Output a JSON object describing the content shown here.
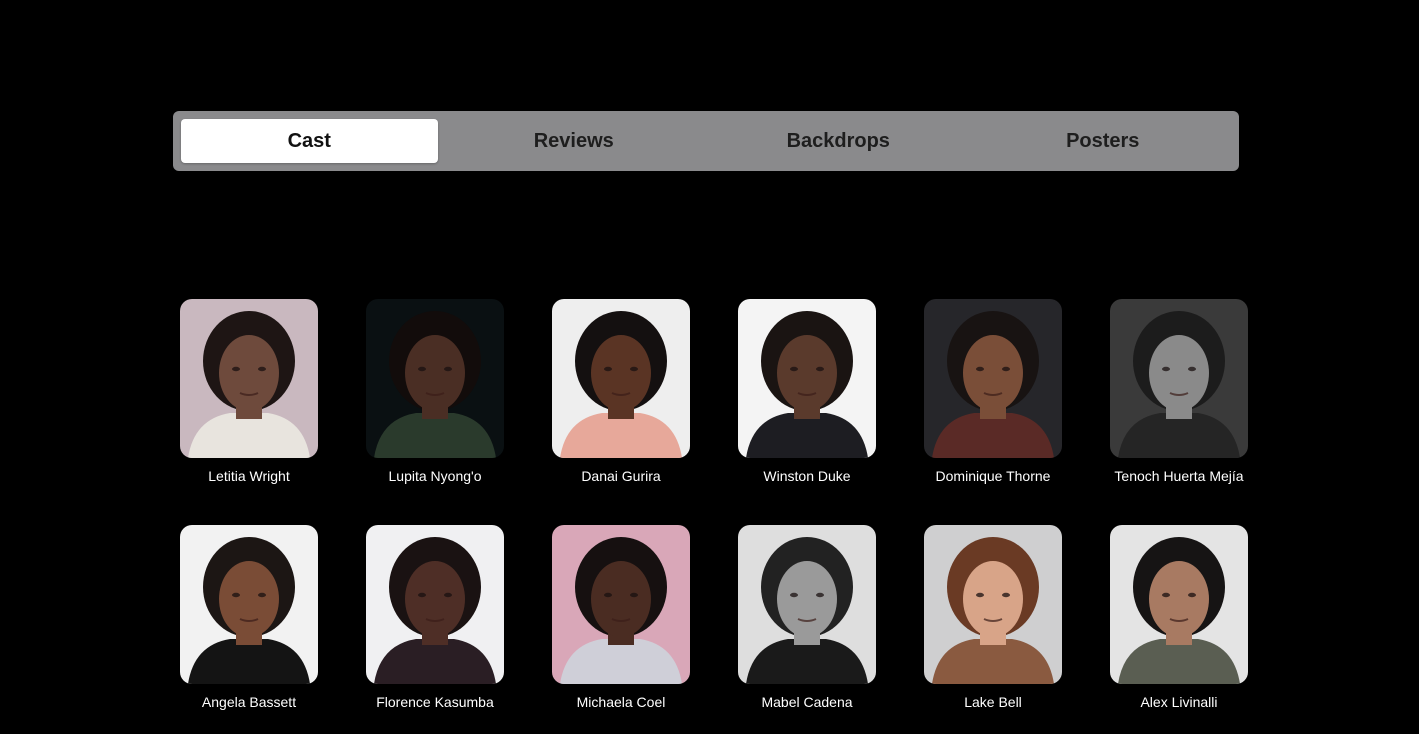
{
  "tabs": [
    {
      "label": "Cast",
      "active": true
    },
    {
      "label": "Reviews",
      "active": false
    },
    {
      "label": "Backdrops",
      "active": false
    },
    {
      "label": "Posters",
      "active": false
    }
  ],
  "cast": [
    {
      "name": "Letitia Wright",
      "bg": "#c9b8bf",
      "skin": "#6e4a3c",
      "hair": "#1e1514",
      "shirt": "#e8e4de"
    },
    {
      "name": "Lupita Nyong'o",
      "bg": "#0a1012",
      "skin": "#4a2e24",
      "hair": "#120c0b",
      "shirt": "#2a3a2c"
    },
    {
      "name": "Danai Gurira",
      "bg": "#eeeeee",
      "skin": "#5a3424",
      "hair": "#141010",
      "shirt": "#e7a89a"
    },
    {
      "name": "Winston Duke",
      "bg": "#f4f4f4",
      "skin": "#5a3a2c",
      "hair": "#1a1412",
      "shirt": "#1d1d22"
    },
    {
      "name": "Dominique Thorne",
      "bg": "#26262a",
      "skin": "#7a4e38",
      "hair": "#181312",
      "shirt": "#5a2a26"
    },
    {
      "name": "Tenoch Huerta Mejía",
      "bg": "#3a3a3a",
      "skin": "#8a8a8a",
      "hair": "#1c1c1c",
      "shirt": "#252525"
    },
    {
      "name": "Angela Bassett",
      "bg": "#f2f2f2",
      "skin": "#7a4c36",
      "hair": "#1c1614",
      "shirt": "#141414"
    },
    {
      "name": "Florence Kasumba",
      "bg": "#f0f0f2",
      "skin": "#4e2e26",
      "hair": "#1a1212",
      "shirt": "#2a1e24"
    },
    {
      "name": "Michaela Coel",
      "bg": "#d9a7b8",
      "skin": "#4a2c22",
      "hair": "#161010",
      "shirt": "#cfcfd8"
    },
    {
      "name": "Mabel Cadena",
      "bg": "#dedede",
      "skin": "#9a9a9a",
      "hair": "#222222",
      "shirt": "#1a1a1a"
    },
    {
      "name": "Lake Bell",
      "bg": "#cfcfd0",
      "skin": "#d8a488",
      "hair": "#6a3a24",
      "shirt": "#8a5a40"
    },
    {
      "name": "Alex Livinalli",
      "bg": "#e4e4e4",
      "skin": "#a87a62",
      "hair": "#161414",
      "shirt": "#5a5e52"
    }
  ]
}
